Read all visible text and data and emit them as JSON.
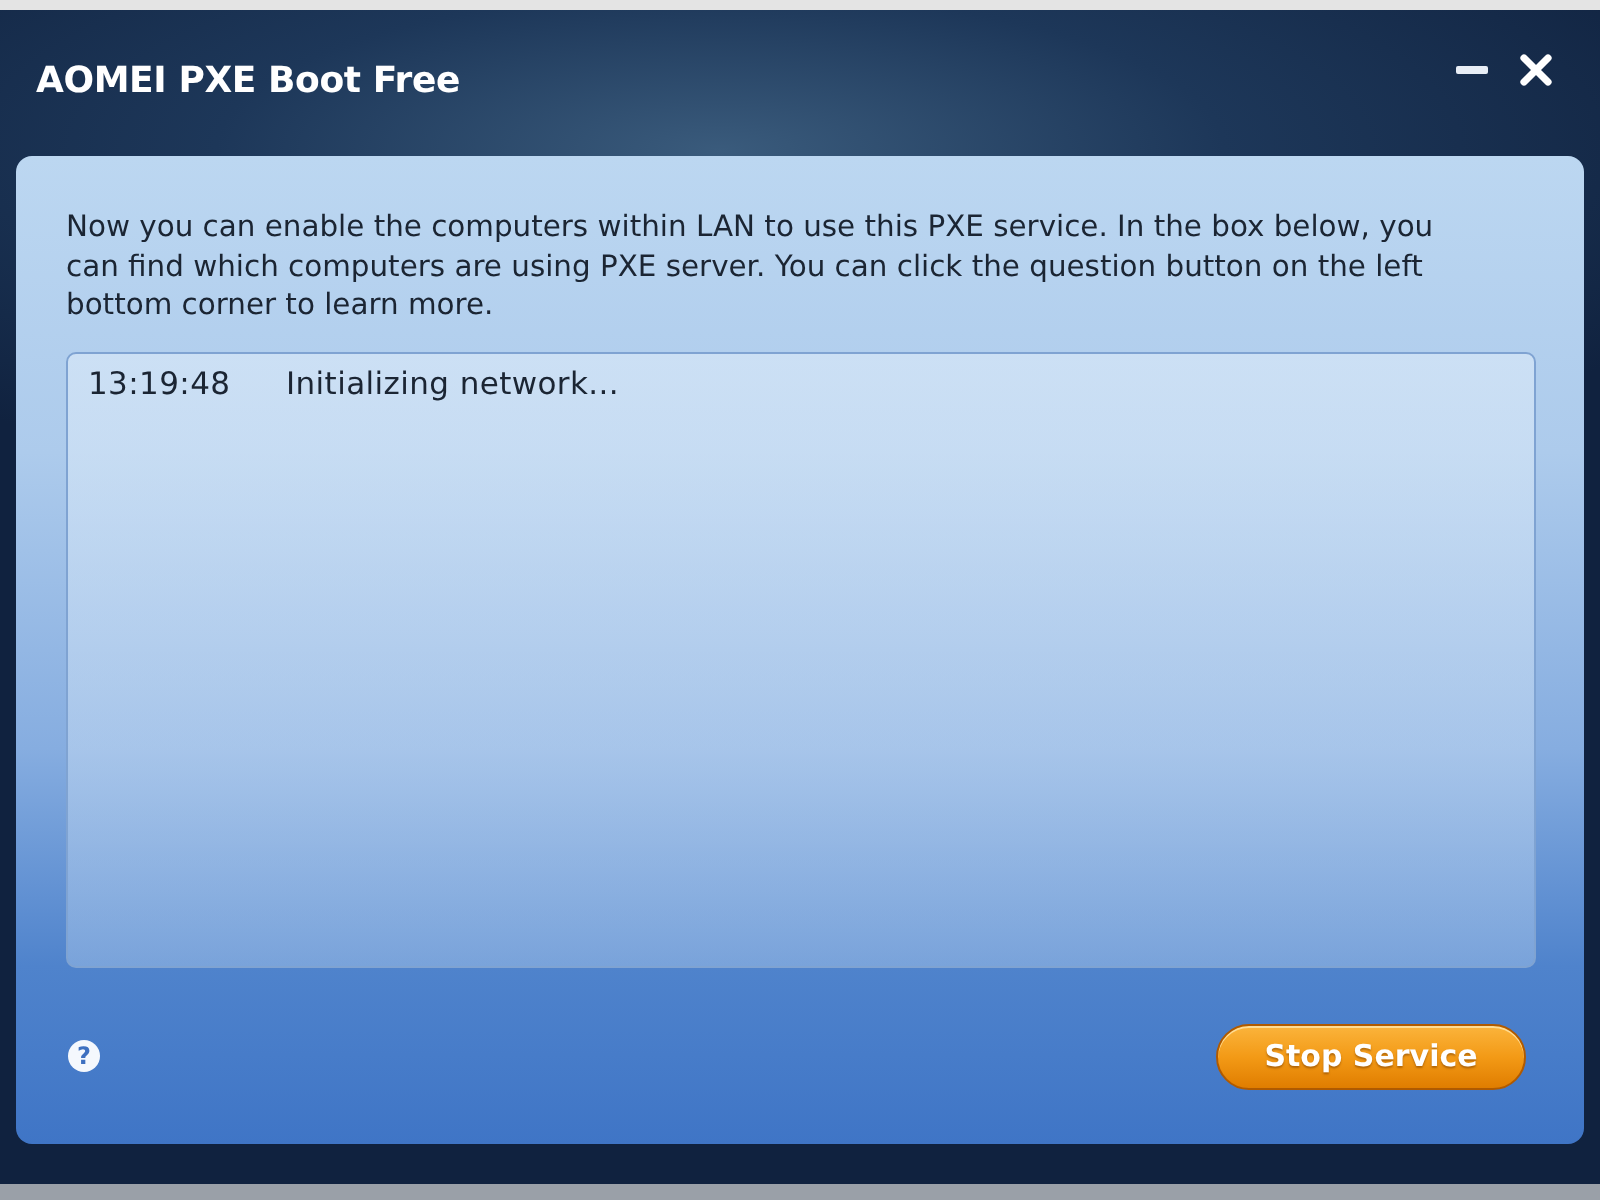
{
  "window": {
    "title": "AOMEI PXE Boot Free"
  },
  "description": "Now you can enable the computers within LAN to use this PXE service. In the box below, you can find which computers are using PXE server. You can click the question button on the left bottom corner to learn more.",
  "log": {
    "entries": [
      {
        "time": "13:19:48",
        "message": "Initializing network..."
      }
    ]
  },
  "help_button": {
    "label": "?"
  },
  "primary_button": {
    "label": "Stop Service"
  }
}
